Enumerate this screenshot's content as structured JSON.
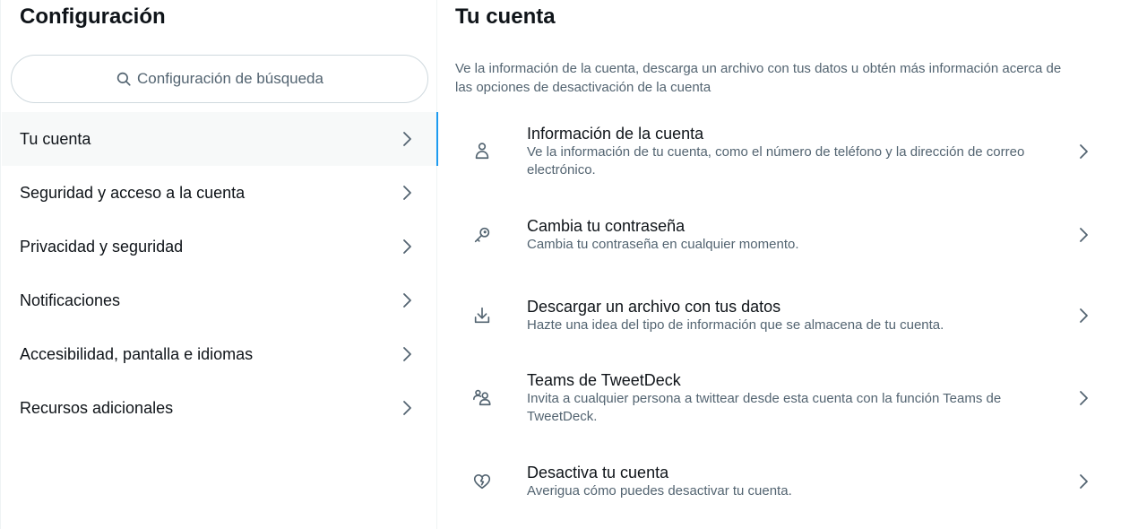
{
  "sidebar": {
    "title": "Configuración",
    "search_placeholder": "Configuración de búsqueda",
    "items": [
      {
        "label": "Tu cuenta"
      },
      {
        "label": "Seguridad y acceso a la cuenta"
      },
      {
        "label": "Privacidad y seguridad"
      },
      {
        "label": "Notificaciones"
      },
      {
        "label": "Accesibilidad, pantalla e idiomas"
      },
      {
        "label": "Recursos adicionales"
      }
    ],
    "active_index": 0
  },
  "main": {
    "title": "Tu cuenta",
    "description": "Ve la información de la cuenta, descarga un archivo con tus datos u obtén más información acerca de las opciones de desactivación de la cuenta",
    "options": [
      {
        "icon": "person-icon",
        "title": "Información de la cuenta",
        "description": "Ve la información de tu cuenta, como el número de teléfono y la dirección de correo electrónico."
      },
      {
        "icon": "key-icon",
        "title": "Cambia tu contraseña",
        "description": "Cambia tu contraseña en cualquier momento."
      },
      {
        "icon": "download-icon",
        "title": "Descargar un archivo con tus datos",
        "description": "Hazte una idea del tipo de información que se almacena de tu cuenta."
      },
      {
        "icon": "people-icon",
        "title": "Teams de TweetDeck",
        "description": "Invita a cualquier persona a twittear desde esta cuenta con la función Teams de TweetDeck."
      },
      {
        "icon": "broken-heart-icon",
        "title": "Desactiva tu cuenta",
        "description": "Averigua cómo puedes desactivar tu cuenta."
      }
    ]
  },
  "colors": {
    "accent": "#1d9bf0",
    "text_primary": "#0f1419",
    "text_secondary": "#536471",
    "active_bg": "#f7f9f9",
    "border": "#eff3f4"
  }
}
